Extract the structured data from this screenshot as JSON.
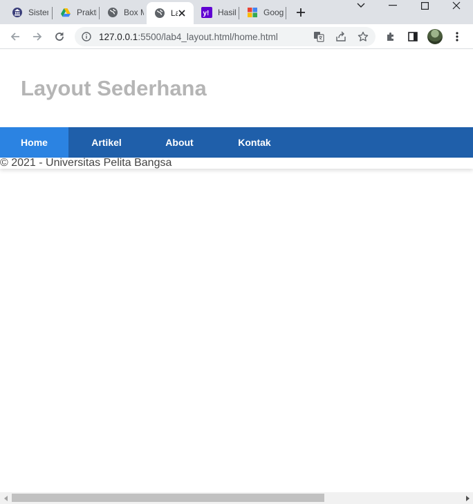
{
  "tabs": [
    {
      "title": "Sistem",
      "icon": "university-icon"
    },
    {
      "title": "Praktikum",
      "icon": "google-drive-icon"
    },
    {
      "title": "Box Model",
      "icon": "globe-icon"
    },
    {
      "title": "Lab",
      "icon": "globe-icon",
      "active": true
    },
    {
      "title": "Hasil",
      "icon": "yahoo-icon"
    },
    {
      "title": "Google",
      "icon": "google-icon"
    }
  ],
  "address_bar": {
    "host": "127.0.0.1",
    "path": ":5500/lab4_layout.html/home.html"
  },
  "page": {
    "title": "Layout Sederhana",
    "nav": [
      {
        "label": "Home",
        "active": true
      },
      {
        "label": "Artikel"
      },
      {
        "label": "About"
      },
      {
        "label": "Kontak"
      }
    ],
    "footer": "© 2021 - Universitas Pelita Bangsa"
  },
  "colors": {
    "nav_bg": "#1f5faa",
    "nav_active": "#2b83e2",
    "title": "#b5b5b5"
  }
}
